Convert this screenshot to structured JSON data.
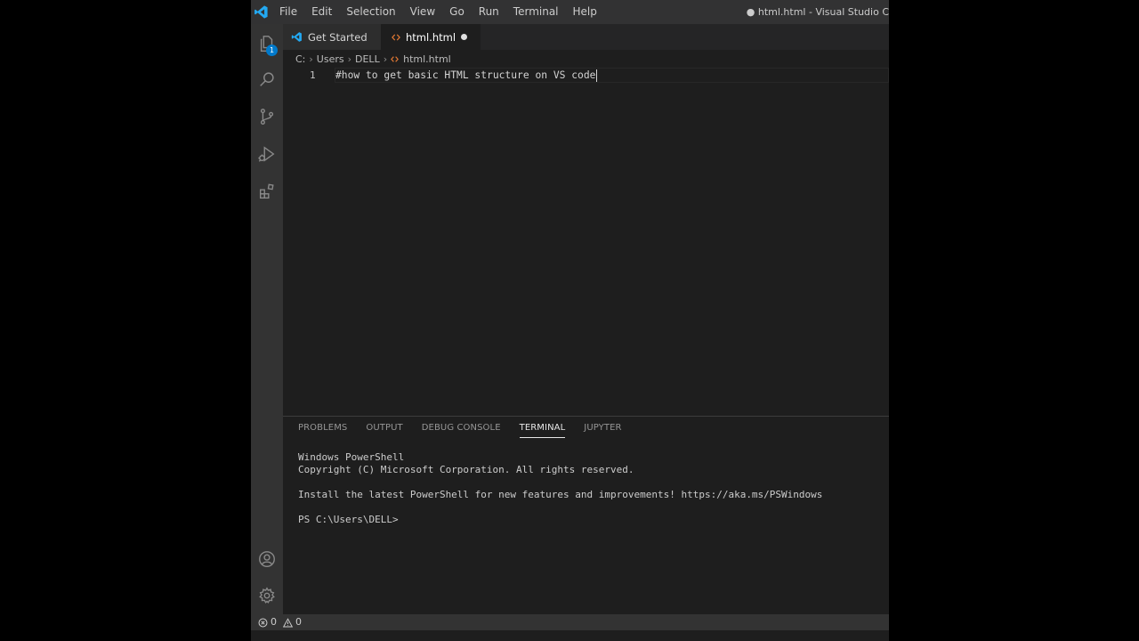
{
  "menu": [
    "File",
    "Edit",
    "Selection",
    "View",
    "Go",
    "Run",
    "Terminal",
    "Help"
  ],
  "window_title": "● html.html - Visual Studio C",
  "activity": {
    "explorer_badge": "1"
  },
  "tabs": [
    {
      "label": "Get Started"
    },
    {
      "label": "html.html"
    }
  ],
  "breadcrumb": [
    "C:",
    "Users",
    "DELL",
    "html.html"
  ],
  "editor": {
    "line_number": "1",
    "line_text": "#how to get basic HTML structure on VS code"
  },
  "panel": {
    "tabs": [
      "PROBLEMS",
      "OUTPUT",
      "DEBUG CONSOLE",
      "TERMINAL",
      "JUPYTER"
    ],
    "active_tab": "TERMINAL",
    "terminal_lines": [
      "Windows PowerShell",
      "Copyright (C) Microsoft Corporation. All rights reserved.",
      "",
      "Install the latest PowerShell for new features and improvements! https://aka.ms/PSWindows",
      "",
      "PS C:\\Users\\DELL>"
    ]
  },
  "status": {
    "errors": "0",
    "warnings": "0"
  },
  "colors": {
    "accent": "#007acc",
    "html_icon": "#e37933",
    "vs_blue": "#23a9f2"
  },
  "icons": [
    "vscode-logo-icon",
    "explorer-icon",
    "search-icon",
    "source-control-icon",
    "run-debug-icon",
    "extensions-icon",
    "account-icon",
    "gear-icon",
    "html-file-icon",
    "error-icon",
    "warning-icon"
  ]
}
